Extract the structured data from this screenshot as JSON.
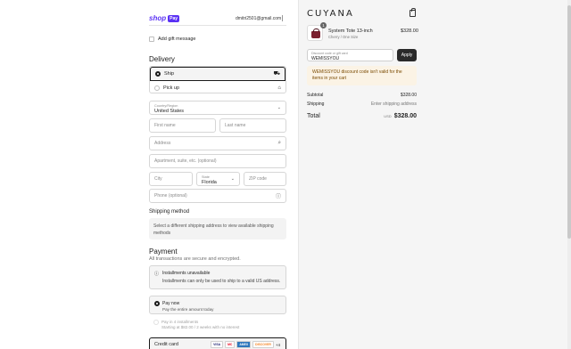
{
  "header": {
    "shoppay_shop": "shop",
    "shoppay_pay": "Pay",
    "account_email": "dmitri2501@gmail.com"
  },
  "gift": {
    "label": "Add gift message"
  },
  "delivery": {
    "title": "Delivery",
    "options": [
      {
        "label": "Ship",
        "selected": true,
        "icon": "truck-icon"
      },
      {
        "label": "Pick up",
        "selected": false,
        "icon": "store-icon"
      }
    ],
    "country_label": "Country/Region",
    "country_value": "United States",
    "first_name_ph": "First name",
    "last_name_ph": "Last name",
    "address_ph": "Address",
    "apartment_ph": "Apartment, suite, etc. (optional)",
    "city_ph": "City",
    "state_label": "State",
    "state_value": "Florida",
    "zip_ph": "ZIP code",
    "phone_ph": "Phone (optional)"
  },
  "shipping_method": {
    "title": "Shipping method",
    "message": "Select a different shipping address to view available shipping methods"
  },
  "payment": {
    "title": "Payment",
    "subtitle": "All transactions are secure and encrypted.",
    "installments_title": "Installments unavailable",
    "installments_msg": "Installments can only be used to ship to a valid US address.",
    "pay_now_title": "Pay now",
    "pay_now_sub": "Pay the entire amount today",
    "pay_later_title": "Pay in 4 installments",
    "pay_later_sub": "Starting at $82.00 / 2 weeks with no interest",
    "credit_card_label": "Credit card",
    "card_logos": [
      "VISA",
      "MC",
      "AMEX",
      "DISCOVER"
    ],
    "more_cards": "+4"
  },
  "summary": {
    "brand": "CUYANA",
    "product": {
      "name": "System Tote 13-inch",
      "variant": "Cherry / One Size",
      "price": "$328.00",
      "quantity": "1"
    },
    "discount_label": "Discount code or gift card",
    "discount_value": "WEMISSYOU",
    "apply_label": "Apply",
    "warning": "WEMISSYOU discount code isn't valid for the items in your cart",
    "subtotal_label": "Subtotal",
    "subtotal_value": "$328.00",
    "shipping_label": "Shipping",
    "shipping_value": "Enter shipping address",
    "total_label": "Total",
    "total_currency": "USD",
    "total_value": "$328.00"
  },
  "colors": {
    "shoppay": "#5a31f4",
    "warning_bg": "#fbf3e5",
    "product_color": "#7a1f2e"
  }
}
